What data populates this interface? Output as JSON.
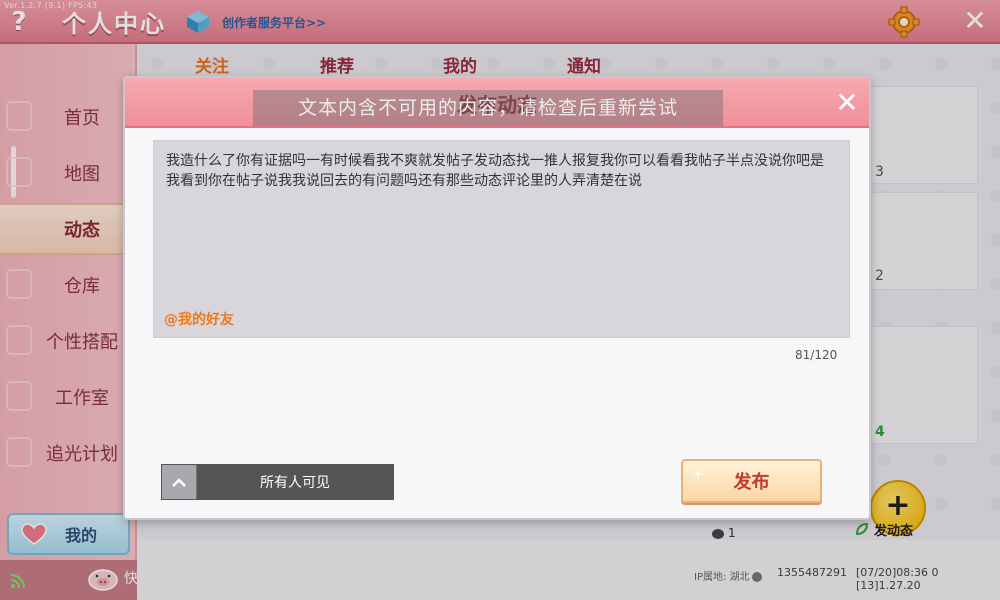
{
  "topbar": {
    "help_label": "?",
    "version": "Ver.1.2.7 (9.1) FPS:43",
    "title": "个人中心",
    "creator_link": "创作者服务平台>>",
    "close_label": "✕"
  },
  "sidebar": {
    "items": [
      {
        "label": "首页"
      },
      {
        "label": "地图"
      },
      {
        "label": "动态"
      },
      {
        "label": "仓库"
      },
      {
        "label": "个性搭配"
      },
      {
        "label": "工作室"
      },
      {
        "label": "追光计划"
      }
    ],
    "active_index": 2,
    "mine_label": "我的",
    "bottom_partial": "快"
  },
  "tabs": [
    {
      "label": "关注",
      "active": true
    },
    {
      "label": "推荐",
      "active": false
    },
    {
      "label": "我的",
      "active": false
    },
    {
      "label": "通知",
      "active": false
    }
  ],
  "feed": {
    "numbers": [
      "3",
      "2",
      "4"
    ],
    "comment_count": "1",
    "publish_label": "发动态",
    "publish_plus": "+",
    "ip_label": "IP属地: 湖北",
    "user_id": "1355487291",
    "time_text": "[07/20]08:36 0 [13]1.27.20"
  },
  "modal": {
    "title": "发布动态",
    "close_label": "✕",
    "toast": "文本内含不可用的内容，请检查后重新尝试",
    "post_text": "我造什么了你有证据吗一有时候看我不爽就发帖子发动态找一推人报复我你可以看看我帖子半点没说你吧是我看到你在帖子说我我说回去的有问题吗还有那些动态评论里的人弄清楚在说",
    "mention": "@我的好友",
    "counter": "81/120",
    "visibility": "所有人可见",
    "publish_label": "发布"
  },
  "colors": {
    "header_pink": "#ef8f9b",
    "active_tab": "#ec6f1f",
    "tab_text": "#9b2c3f",
    "mention": "#ec7a22",
    "publish_text": "#c0392b"
  }
}
